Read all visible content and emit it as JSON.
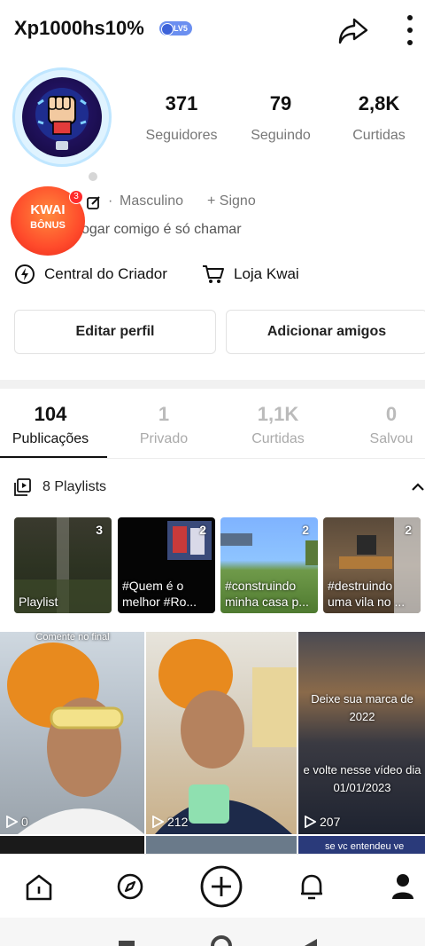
{
  "header": {
    "username": "Xp1000hs10%",
    "level_badge": "LV5"
  },
  "profile": {
    "stats": [
      {
        "value": "371",
        "label": "Seguidores"
      },
      {
        "value": "79",
        "label": "Seguindo"
      },
      {
        "value": "2,8K",
        "label": "Curtidas"
      }
    ],
    "gender": "Masculino",
    "sign": "+ Signo",
    "bio": "ogar comigo é só chamar"
  },
  "kwai_bonus": {
    "line1": "KWAI",
    "line2": "BÔNUS",
    "notification": "3"
  },
  "creator_links": {
    "creator_center": "Central do Criador",
    "store": "Loja Kwai"
  },
  "actions": {
    "edit_profile": "Editar perfil",
    "add_friends": "Adicionar amigos"
  },
  "tabs": [
    {
      "value": "104",
      "label": "Publicações",
      "active": true
    },
    {
      "value": "1",
      "label": "Privado"
    },
    {
      "value": "1,1K",
      "label": "Curtidas"
    },
    {
      "value": "0",
      "label": "Salvou"
    }
  ],
  "playlists": {
    "header": "8 Playlists",
    "items": [
      {
        "count": "3",
        "title": "Playlist"
      },
      {
        "count": "2",
        "title": "#Quem é o melhor #Ro..."
      },
      {
        "count": "2",
        "title": "#construindo minha casa p..."
      },
      {
        "count": "2",
        "title": "#destruindo uma vila no ..."
      }
    ]
  },
  "videos": [
    {
      "views": "0",
      "overlay_top": "Comente no final"
    },
    {
      "views": "212"
    },
    {
      "views": "207",
      "overlay_1": "Deixe sua marca de",
      "overlay_2": "2022",
      "overlay_3": "e volte nesse vídeo dia",
      "overlay_4": "01/01/2023"
    }
  ],
  "row2": {
    "partial_text": "se vc entendeu ve"
  },
  "colors": {
    "accent": "#ff4b2b",
    "badge": "#6b8ff0",
    "muted_text": "#777777"
  }
}
